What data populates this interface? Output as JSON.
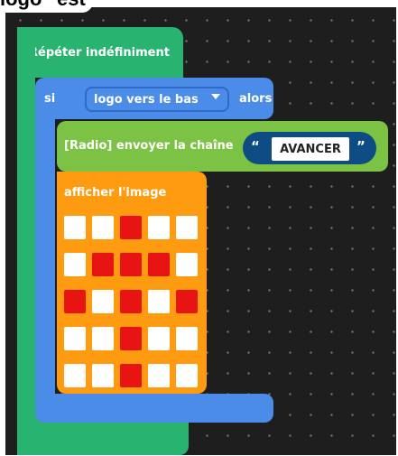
{
  "caption": "logo\" est",
  "forever": {
    "label": "Répéter indéfiniment"
  },
  "if_block": {
    "label_if": "si",
    "condition": "logo vers le bas",
    "label_then": "alors"
  },
  "radio_send": {
    "label": "[Radio] envoyer la chaîne",
    "open_quote": "“",
    "close_quote": "”",
    "value": "AVANCER"
  },
  "show_image": {
    "label": "afficher l'image",
    "grid": [
      [
        0,
        0,
        1,
        0,
        0
      ],
      [
        0,
        1,
        1,
        1,
        0
      ],
      [
        1,
        0,
        1,
        0,
        1
      ],
      [
        0,
        0,
        1,
        0,
        0
      ],
      [
        0,
        0,
        1,
        0,
        0
      ]
    ]
  },
  "colors": {
    "workspace_bg": "#1e1e1e",
    "loop_green": "#28b371",
    "if_blue": "#4a8ce8",
    "radio_green": "#7cc244",
    "image_orange": "#ff9b10",
    "string_pill": "#0e4d84",
    "led_on": "#e81414",
    "led_off": "#ffffff"
  },
  "icons": {
    "dropdown": "chevron-down-icon"
  }
}
